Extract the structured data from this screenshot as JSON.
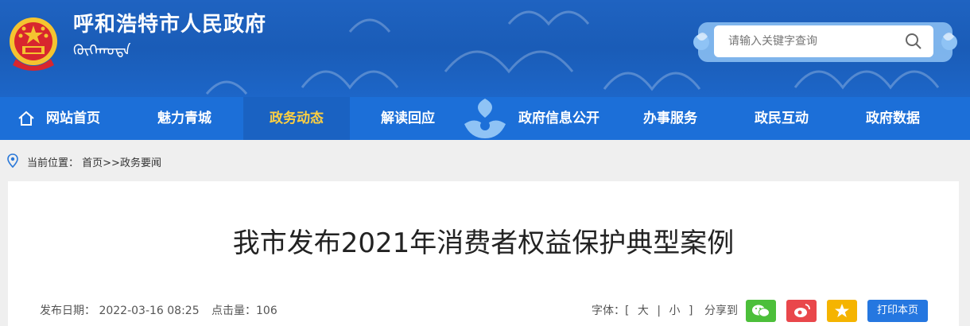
{
  "header": {
    "title": "呼和浩特市人民政府",
    "mongolian_title": "ᠬᠥᠬᠡᠬᠣᠲᠠ",
    "search_placeholder": "请输入关键字查询"
  },
  "nav": {
    "items": [
      {
        "label": "网站首页"
      },
      {
        "label": "魅力青城"
      },
      {
        "label": "政务动态"
      },
      {
        "label": "解读回应"
      },
      {
        "label": "政府信息公开"
      },
      {
        "label": "办事服务"
      },
      {
        "label": "政民互动"
      },
      {
        "label": "政府数据"
      }
    ],
    "active_index": 2
  },
  "breadcrumb": {
    "prefix": "当前位置：",
    "path": "首页>>政务要闻"
  },
  "article": {
    "title": "我市发布2021年消费者权益保护典型案例",
    "publish_label": "发布日期：",
    "publish_date": "2022-03-16 08:25",
    "hits_label": "点击量：",
    "hits": "106",
    "font_label": "字体：[",
    "font_large": "大",
    "font_small": "小",
    "font_end": "]",
    "share_label": "分享到",
    "print_label": "打印本页"
  },
  "colors": {
    "header_blue": "#1f63c1",
    "nav_blue": "#1c6fd8",
    "active_yellow": "#ffd040",
    "wechat_green": "#4cbf3a",
    "weibo_red": "#e9474b",
    "qzone_yellow": "#f5b400",
    "print_blue": "#2577e0"
  }
}
